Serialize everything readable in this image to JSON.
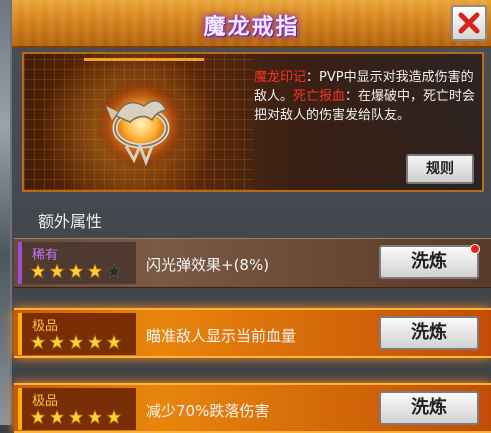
{
  "dialog": {
    "title": "魔龙戒指",
    "close_icon": "close-x-icon"
  },
  "item": {
    "icon": "dragon-ring-icon",
    "description_parts": [
      {
        "text": "魔龙印记",
        "color": "#ff3322"
      },
      {
        "text": "：PVP中显示对我造成伤害的敌人。",
        "color": "#f2f2f2"
      },
      {
        "text": "死亡报血",
        "color": "#ff3322"
      },
      {
        "text": "：在爆破中，死亡时会把对敌人的伤害发给队友。",
        "color": "#f2f2f2"
      }
    ],
    "rules_button": "规则"
  },
  "extra_attributes": {
    "title": "额外属性",
    "rows": [
      {
        "quality": "稀有",
        "stars_filled": 4,
        "stars_total": 5,
        "text": "闪光弹效果+(8%)",
        "button": "洗炼",
        "has_red_dot": true
      },
      {
        "quality": "极品",
        "stars_filled": 5,
        "stars_total": 5,
        "text": "瞄准敌人显示当前血量",
        "button": "洗炼",
        "has_red_dot": false
      },
      {
        "quality": "极品",
        "stars_filled": 5,
        "stars_total": 5,
        "text": "减少70%跌落伤害",
        "button": "洗炼",
        "has_red_dot": false
      }
    ]
  },
  "colors": {
    "title_bar": "#d4821b",
    "rare": "#a24cd6",
    "epic": "#ffb000",
    "highlight_red": "#ff3322"
  }
}
